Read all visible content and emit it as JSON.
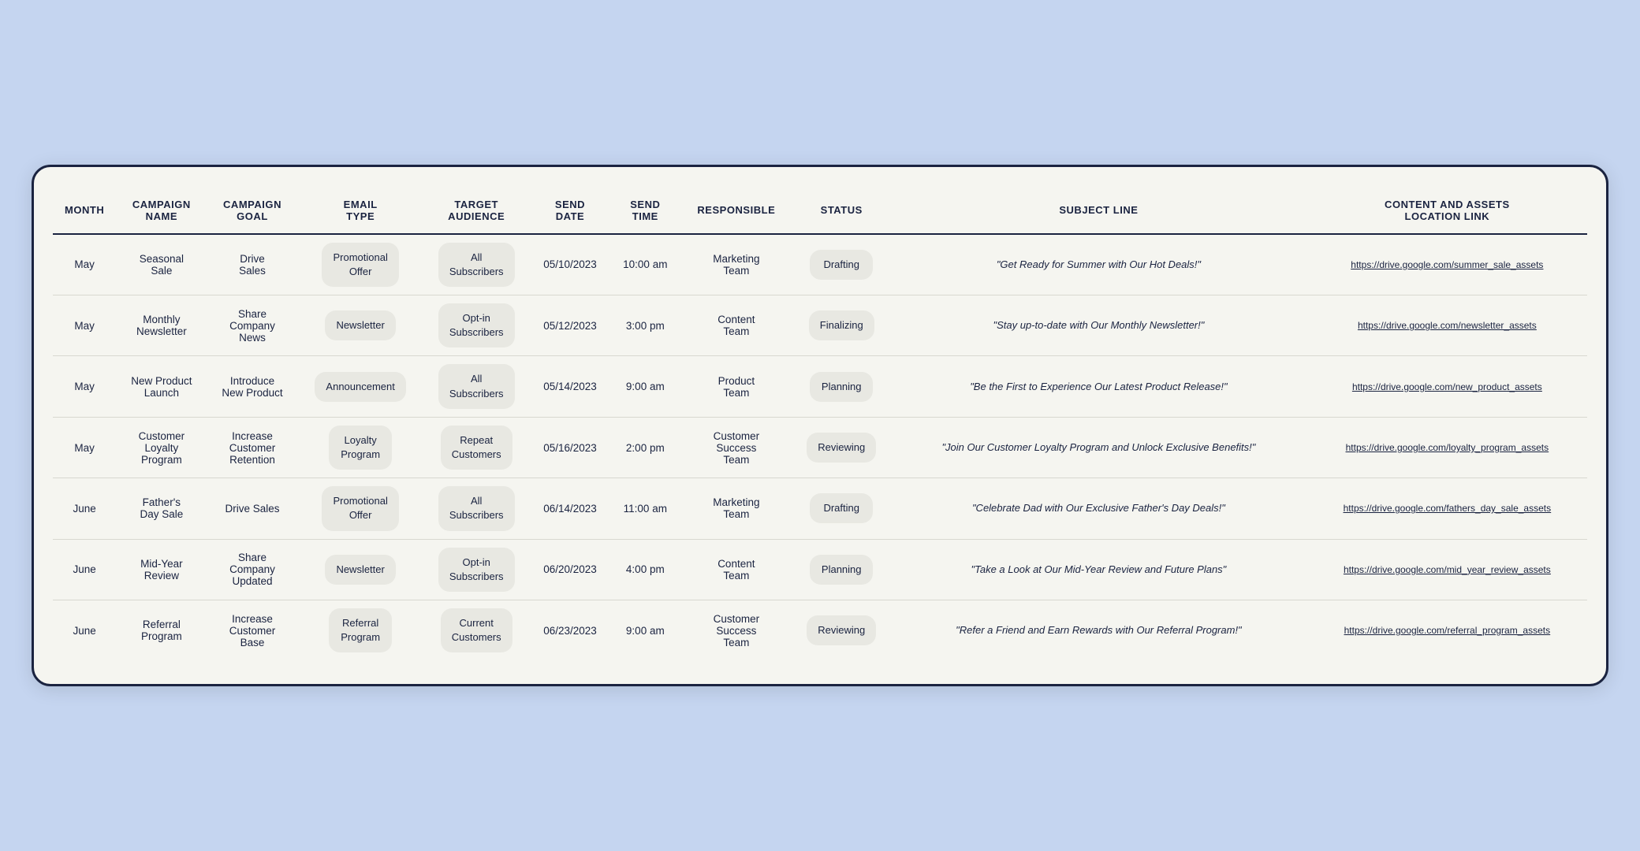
{
  "table": {
    "headers": [
      {
        "key": "month",
        "label": "MONTH"
      },
      {
        "key": "campaign_name",
        "label": "CAMPAIGN\nNAME"
      },
      {
        "key": "campaign_goal",
        "label": "CAMPAIGN\nGOAL"
      },
      {
        "key": "email_type",
        "label": "EMAIL\nTYPE"
      },
      {
        "key": "target_audience",
        "label": "TARGET\nAUDIENCE"
      },
      {
        "key": "send_date",
        "label": "SEND\nDATE"
      },
      {
        "key": "send_time",
        "label": "SEND\nTIME"
      },
      {
        "key": "responsible",
        "label": "RESPONSIBLE"
      },
      {
        "key": "status",
        "label": "STATUS"
      },
      {
        "key": "subject_line",
        "label": "SUBJECT LINE"
      },
      {
        "key": "content_link",
        "label": "CONTENT AND ASSETS\nLOCATION LINK"
      }
    ],
    "rows": [
      {
        "month": "May",
        "campaign_name": "Seasonal\nSale",
        "campaign_goal": "Drive\nSales",
        "email_type": "Promotional\nOffer",
        "target_audience": "All\nSubscribers",
        "send_date": "05/10/2023",
        "send_time": "10:00 am",
        "responsible": "Marketing\nTeam",
        "status": "Drafting",
        "subject_line": "\"Get Ready for Summer with Our Hot Deals!\"",
        "content_link": "https://drive.google.com/summer_sale_assets"
      },
      {
        "month": "May",
        "campaign_name": "Monthly\nNewsletter",
        "campaign_goal": "Share\nCompany\nNews",
        "email_type": "Newsletter",
        "target_audience": "Opt-in\nSubscribers",
        "send_date": "05/12/2023",
        "send_time": "3:00 pm",
        "responsible": "Content\nTeam",
        "status": "Finalizing",
        "subject_line": "\"Stay up-to-date with Our Monthly Newsletter!\"",
        "content_link": "https://drive.google.com/newsletter_assets"
      },
      {
        "month": "May",
        "campaign_name": "New Product\nLaunch",
        "campaign_goal": "Introduce\nNew Product",
        "email_type": "Announcement",
        "target_audience": "All\nSubscribers",
        "send_date": "05/14/2023",
        "send_time": "9:00 am",
        "responsible": "Product\nTeam",
        "status": "Planning",
        "subject_line": "\"Be the First to Experience Our Latest Product Release!\"",
        "content_link": "https://drive.google.com/new_product_assets"
      },
      {
        "month": "May",
        "campaign_name": "Customer\nLoyalty\nProgram",
        "campaign_goal": "Increase\nCustomer\nRetention",
        "email_type": "Loyalty\nProgram",
        "target_audience": "Repeat\nCustomers",
        "send_date": "05/16/2023",
        "send_time": "2:00 pm",
        "responsible": "Customer\nSuccess\nTeam",
        "status": "Reviewing",
        "subject_line": "\"Join Our Customer Loyalty Program and Unlock Exclusive Benefits!\"",
        "content_link": "https://drive.google.com/loyalty_program_assets"
      },
      {
        "month": "June",
        "campaign_name": "Father's\nDay Sale",
        "campaign_goal": "Drive Sales",
        "email_type": "Promotional\nOffer",
        "target_audience": "All\nSubscribers",
        "send_date": "06/14/2023",
        "send_time": "11:00 am",
        "responsible": "Marketing\nTeam",
        "status": "Drafting",
        "subject_line": "\"Celebrate Dad with Our Exclusive Father's Day Deals!\"",
        "content_link": "https://drive.google.com/fathers_day_sale_assets"
      },
      {
        "month": "June",
        "campaign_name": "Mid-Year\nReview",
        "campaign_goal": "Share\nCompany\nUpdated",
        "email_type": "Newsletter",
        "target_audience": "Opt-in\nSubscribers",
        "send_date": "06/20/2023",
        "send_time": "4:00 pm",
        "responsible": "Content\nTeam",
        "status": "Planning",
        "subject_line": "\"Take a Look at Our Mid-Year Review and Future Plans\"",
        "content_link": "https://drive.google.com/mid_year_review_assets"
      },
      {
        "month": "June",
        "campaign_name": "Referral\nProgram",
        "campaign_goal": "Increase\nCustomer\nBase",
        "email_type": "Referral\nProgram",
        "target_audience": "Current\nCustomers",
        "send_date": "06/23/2023",
        "send_time": "9:00 am",
        "responsible": "Customer\nSuccess\nTeam",
        "status": "Reviewing",
        "subject_line": "\"Refer a Friend and Earn Rewards with Our Referral Program!\"",
        "content_link": "https://drive.google.com/referral_program_assets"
      }
    ]
  }
}
